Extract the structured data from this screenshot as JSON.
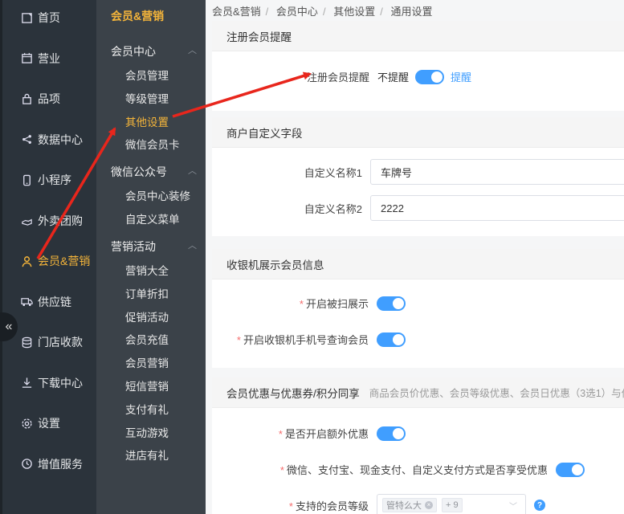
{
  "nav_primary": [
    {
      "label": "首页",
      "icon": "home-icon"
    },
    {
      "label": "营业",
      "icon": "calendar-icon"
    },
    {
      "label": "品项",
      "icon": "bag-icon"
    },
    {
      "label": "数据中心",
      "icon": "share-icon"
    },
    {
      "label": "小程序",
      "icon": "phone-icon"
    },
    {
      "label": "外卖团购",
      "icon": "hand-icon"
    },
    {
      "label": "会员&营销",
      "icon": "user-icon",
      "active": true
    },
    {
      "label": "供应链",
      "icon": "truck-icon"
    },
    {
      "label": "门店收款",
      "icon": "database-icon"
    },
    {
      "label": "下载中心",
      "icon": "download-icon"
    },
    {
      "label": "设置",
      "icon": "gear-icon"
    },
    {
      "label": "增值服务",
      "icon": "clock-icon"
    }
  ],
  "collapse_glyph": "«",
  "nav_secondary": {
    "title": "会员&营销",
    "groups": [
      {
        "label": "会员中心",
        "items": [
          "会员管理",
          "等级管理",
          "其他设置",
          "微信会员卡"
        ]
      },
      {
        "label": "微信公众号",
        "items": [
          "会员中心装修",
          "自定义菜单"
        ]
      },
      {
        "label": "营销活动",
        "items": [
          "营销大全",
          "订单折扣",
          "促销活动",
          "会员充值",
          "会员营销",
          "短信营销",
          "支付有礼",
          "互动游戏",
          "进店有礼"
        ]
      }
    ],
    "chevron_glyph": "︿"
  },
  "breadcrumb": [
    "会员&营销",
    "会员中心",
    "其他设置",
    "通用设置"
  ],
  "register_reminder": {
    "heading": "注册会员提醒",
    "label": "注册会员提醒",
    "off_text": "不提醒",
    "on_text": "提醒",
    "enabled": true
  },
  "custom_fields": {
    "heading": "商户自定义字段",
    "fields": [
      {
        "label": "自定义名称1",
        "value": "车牌号"
      },
      {
        "label": "自定义名称2",
        "value": "2222"
      }
    ]
  },
  "cashier_display": {
    "heading": "收银机展示会员信息",
    "options": [
      {
        "label": "开启被扫展示",
        "required": true,
        "enabled": true
      },
      {
        "label": "开启收银机手机号查询会员",
        "required": true,
        "enabled": true
      }
    ]
  },
  "discount_sharing": {
    "heading": "会员优惠与优惠券/积分同享",
    "hint": "商品会员价优惠、会员等级优惠、会员日优惠（3选1）与优",
    "options": [
      {
        "label": "是否开启额外优惠",
        "required": true,
        "enabled": true
      },
      {
        "label": "微信、支付宝、现金支付、自定义支付方式是否享受优惠",
        "required": true,
        "enabled": true
      }
    ],
    "level_select": {
      "label": "支持的会员等级",
      "required": true,
      "tag": "管特么大",
      "more": "+ 9",
      "help_glyph": "?"
    }
  }
}
